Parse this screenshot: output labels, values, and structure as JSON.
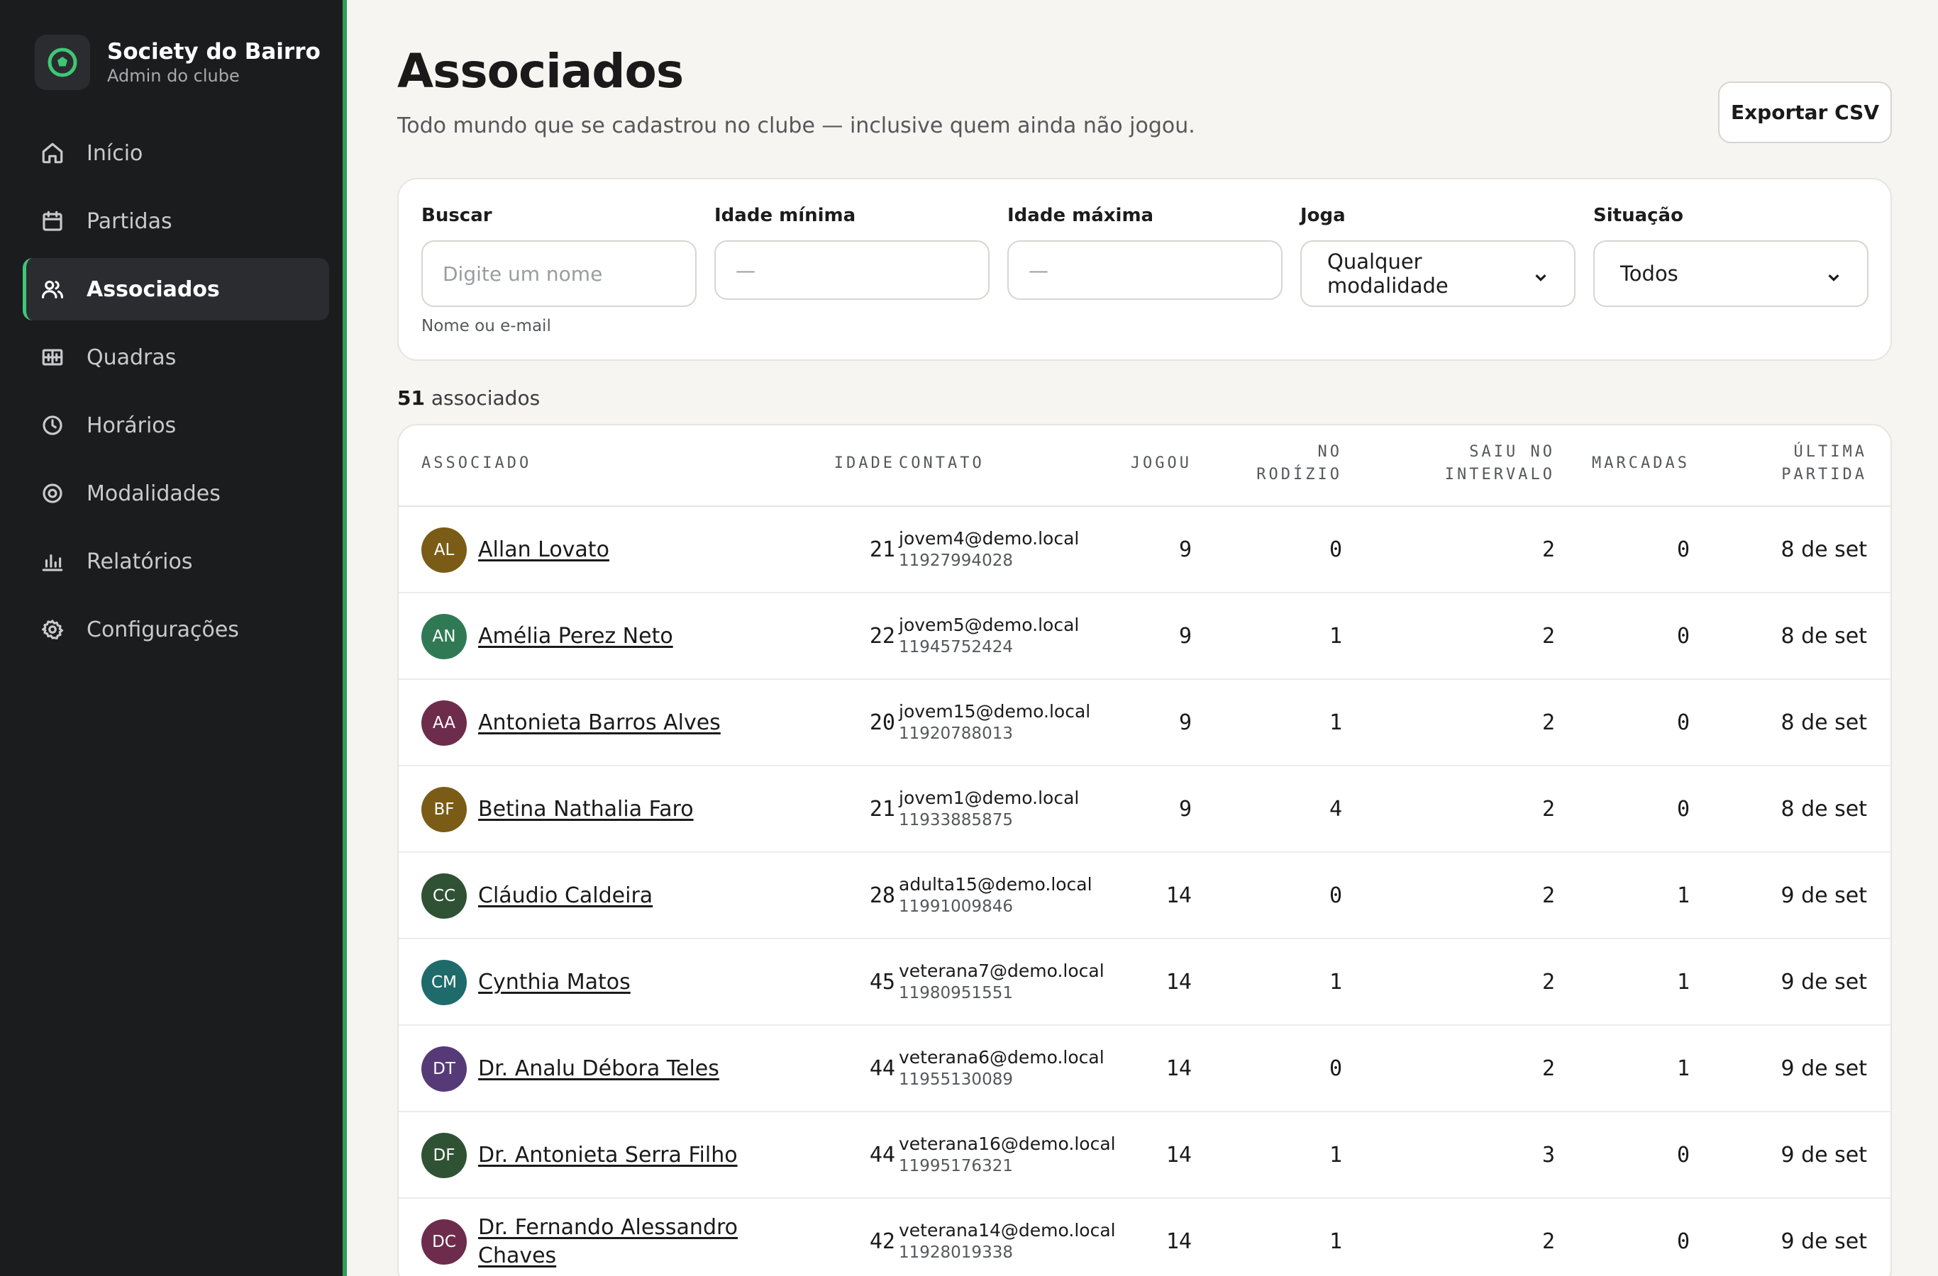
{
  "brand": {
    "name": "Society do Bairro",
    "subtitle": "Admin do clube"
  },
  "nav": [
    {
      "label": "Início",
      "icon": "home-icon",
      "active": false
    },
    {
      "label": "Partidas",
      "icon": "calendar-icon",
      "active": false
    },
    {
      "label": "Associados",
      "icon": "users-icon",
      "active": true
    },
    {
      "label": "Quadras",
      "icon": "court-icon",
      "active": false
    },
    {
      "label": "Horários",
      "icon": "clock-icon",
      "active": false
    },
    {
      "label": "Modalidades",
      "icon": "target-icon",
      "active": false
    },
    {
      "label": "Relatórios",
      "icon": "bar-chart-icon",
      "active": false
    },
    {
      "label": "Configurações",
      "icon": "gear-icon",
      "active": false
    }
  ],
  "page": {
    "title": "Associados",
    "subtitle": "Todo mundo que se cadastrou no clube — inclusive quem ainda não jogou.",
    "export_label": "Exportar CSV"
  },
  "filters": {
    "search": {
      "label": "Buscar",
      "placeholder": "Digite um nome",
      "hint": "Nome ou e-mail"
    },
    "min_age": {
      "label": "Idade mínima",
      "placeholder": "—"
    },
    "max_age": {
      "label": "Idade máxima",
      "placeholder": "—"
    },
    "plays": {
      "label": "Joga",
      "value": "Qualquer modalidade"
    },
    "status": {
      "label": "Situação",
      "value": "Todos"
    }
  },
  "count": {
    "number": "51",
    "label": " associados"
  },
  "table": {
    "headers": {
      "member": "ASSOCIADO",
      "age": "IDADE",
      "contact": "CONTATO",
      "played": "JOGOU",
      "rotation": [
        "NO",
        "RODÍZIO"
      ],
      "left_break": [
        "SAIU NO",
        "INTERVALO"
      ],
      "scheduled": "MARCADAS",
      "last_match": [
        "ÚLTIMA",
        "PARTIDA"
      ]
    },
    "rows": [
      {
        "initials": "AL",
        "color": "#7a5c17",
        "name": "Allan Lovato",
        "age": "21",
        "email": "jovem4@demo.local",
        "phone": "11927994028",
        "played": "9",
        "rotation": "0",
        "left_break": "2",
        "scheduled": "0",
        "last": "8 de set"
      },
      {
        "initials": "AN",
        "color": "#2f7a55",
        "name": "Amélia Perez Neto",
        "age": "22",
        "email": "jovem5@demo.local",
        "phone": "11945752424",
        "played": "9",
        "rotation": "1",
        "left_break": "2",
        "scheduled": "0",
        "last": "8 de set"
      },
      {
        "initials": "AA",
        "color": "#6e2c4c",
        "name": "Antonieta Barros Alves",
        "age": "20",
        "email": "jovem15@demo.local",
        "phone": "11920788013",
        "played": "9",
        "rotation": "1",
        "left_break": "2",
        "scheduled": "0",
        "last": "8 de set"
      },
      {
        "initials": "BF",
        "color": "#7a5c17",
        "name": "Betina Nathalia Faro",
        "age": "21",
        "email": "jovem1@demo.local",
        "phone": "11933885875",
        "played": "9",
        "rotation": "4",
        "left_break": "2",
        "scheduled": "0",
        "last": "8 de set"
      },
      {
        "initials": "CC",
        "color": "#2f5234",
        "name": "Cláudio Caldeira",
        "age": "28",
        "email": "adulta15@demo.local",
        "phone": "11991009846",
        "played": "14",
        "rotation": "0",
        "left_break": "2",
        "scheduled": "1",
        "last": "9 de set"
      },
      {
        "initials": "CM",
        "color": "#1f6b6b",
        "name": "Cynthia Matos",
        "age": "45",
        "email": "veterana7@demo.local",
        "phone": "11980951551",
        "played": "14",
        "rotation": "1",
        "left_break": "2",
        "scheduled": "1",
        "last": "9 de set"
      },
      {
        "initials": "DT",
        "color": "#563a78",
        "name": "Dr. Analu Débora Teles",
        "age": "44",
        "email": "veterana6@demo.local",
        "phone": "11955130089",
        "played": "14",
        "rotation": "0",
        "left_break": "2",
        "scheduled": "1",
        "last": "9 de set"
      },
      {
        "initials": "DF",
        "color": "#2f5234",
        "name": "Dr. Antonieta Serra Filho",
        "age": "44",
        "email": "veterana16@demo.local",
        "phone": "11995176321",
        "played": "14",
        "rotation": "1",
        "left_break": "3",
        "scheduled": "0",
        "last": "9 de set"
      },
      {
        "initials": "DC",
        "color": "#6e2c4c",
        "name": "Dr. Fernando Alessandro Chaves",
        "age": "42",
        "email": "veterana14@demo.local",
        "phone": "11928019338",
        "played": "14",
        "rotation": "1",
        "left_break": "2",
        "scheduled": "0",
        "last": "9 de set"
      }
    ]
  }
}
